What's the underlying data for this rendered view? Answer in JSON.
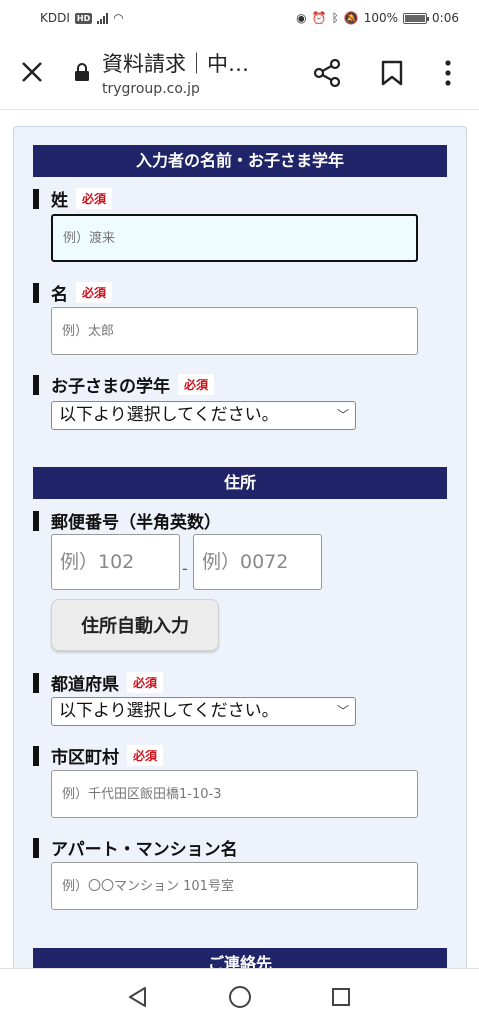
{
  "status_bar": {
    "carrier": "KDDI",
    "hd_badge": "HD",
    "battery": "100%",
    "time": "0:06"
  },
  "browser": {
    "tab_title": "資料請求｜中…",
    "url": "trygroup.co.jp"
  },
  "form": {
    "required_label": "必須",
    "section_name": {
      "title": "入力者の名前・お子さま学年",
      "last_name_label": "姓",
      "last_name_placeholder": "例）渡来",
      "first_name_label": "名",
      "first_name_placeholder": "例）太郎",
      "grade_label": "お子さまの学年",
      "grade_value": "以下より選択してください。"
    },
    "section_address": {
      "title": "住所",
      "zip_label": "郵便番号（半角英数）",
      "zip1_placeholder": "例）102",
      "zip_separator": "-",
      "zip2_placeholder": "例）0072",
      "auto_fill_label": "住所自動入力",
      "prefecture_label": "都道府県",
      "prefecture_value": "以下より選択してください。",
      "city_label": "市区町村",
      "city_placeholder": "例）千代田区飯田橋1-10-3",
      "building_label": "アパート・マンション名",
      "building_placeholder": "例）〇〇マンション 101号室"
    },
    "section_contact": {
      "title": "ご連絡先"
    }
  }
}
